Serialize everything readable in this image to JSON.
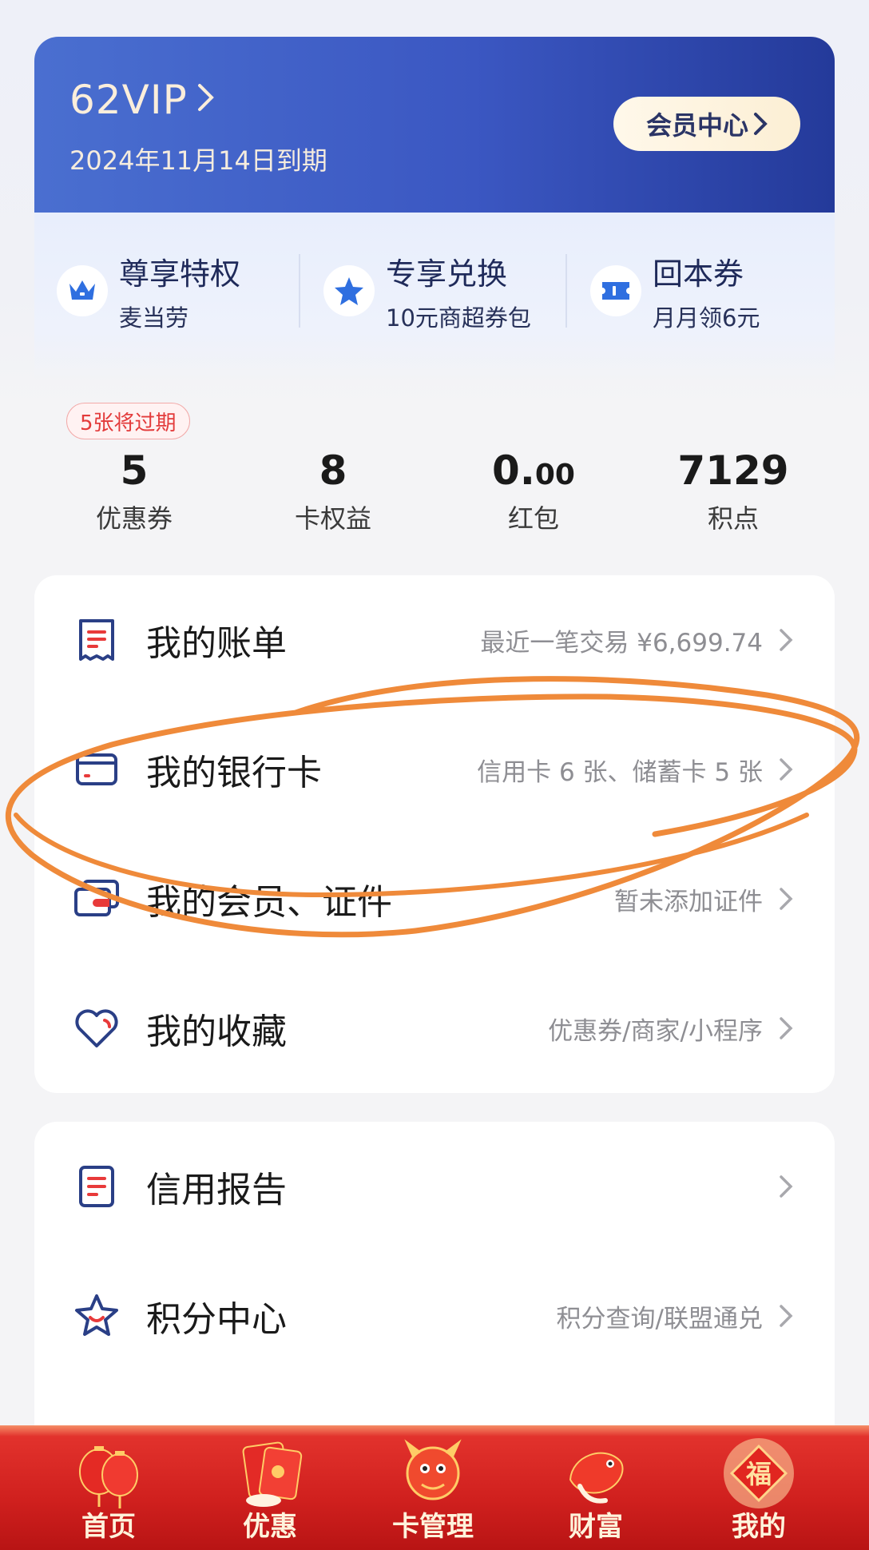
{
  "vip": {
    "title": "62VIP",
    "expire": "2024年11月14日到期",
    "member_center": "会员中心"
  },
  "privileges": [
    {
      "title": "尊享特权",
      "subtitle": "麦当劳",
      "icon": "crown-icon"
    },
    {
      "title": "专享兑换",
      "subtitle": "10元商超券包",
      "icon": "star-icon"
    },
    {
      "title": "回本券",
      "subtitle": "月月领6元",
      "icon": "ticket-icon"
    }
  ],
  "expire_badge": "5张将过期",
  "stats": [
    {
      "value": "5",
      "label": "优惠券"
    },
    {
      "value": "8",
      "label": "卡权益"
    },
    {
      "value_main": "0.",
      "value_cents": "00",
      "label": "红包"
    },
    {
      "value": "7129",
      "label": "积点"
    }
  ],
  "menu": [
    {
      "title": "我的账单",
      "sub": "最近一笔交易 ¥6,699.74",
      "icon": "bill-icon"
    },
    {
      "title": "我的银行卡",
      "sub": "信用卡 6 张、储蓄卡 5 张",
      "icon": "bank-card-icon"
    },
    {
      "title": "我的会员、证件",
      "sub": "暂未添加证件",
      "icon": "member-card-icon"
    },
    {
      "title": "我的收藏",
      "sub": "优惠券/商家/小程序",
      "icon": "heart-icon"
    }
  ],
  "menu2": [
    {
      "title": "信用报告",
      "sub": "",
      "icon": "report-icon"
    },
    {
      "title": "积分中心",
      "sub": "积分查询/联盟通兑",
      "icon": "star-outline-icon"
    }
  ],
  "tabs": [
    {
      "label": "首页",
      "icon": "lantern-icon"
    },
    {
      "label": "优惠",
      "icon": "red-envelope-icon"
    },
    {
      "label": "卡管理",
      "icon": "dragon-icon"
    },
    {
      "label": "财富",
      "icon": "koi-icon"
    },
    {
      "label": "我的",
      "icon": "fu-icon",
      "active": true
    }
  ],
  "colors": {
    "vip_gradient_start": "#4a6fd0",
    "vip_gradient_end": "#243a9a",
    "tabbar_red": "#d0201e",
    "annotation_orange": "#ef8a3a",
    "icon_navy": "#2a3f86",
    "icon_red": "#e83a3a"
  }
}
